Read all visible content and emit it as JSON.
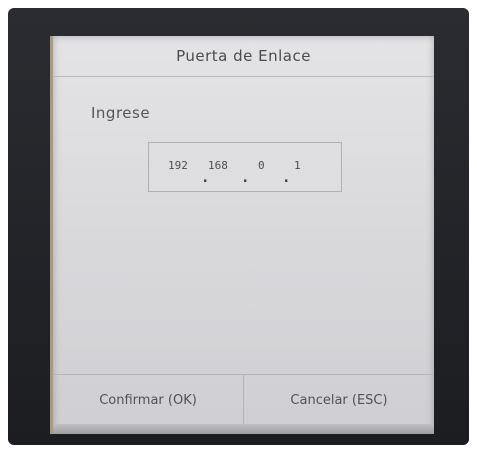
{
  "dialog": {
    "title": "Puerta de Enlace"
  },
  "form": {
    "prompt": "Ingrese",
    "ip": {
      "octet1": "192",
      "octet2": "168",
      "octet3": "0",
      "octet4": "1"
    }
  },
  "buttons": {
    "confirm": "Confirmar (OK)",
    "cancel": "Cancelar (ESC)"
  }
}
